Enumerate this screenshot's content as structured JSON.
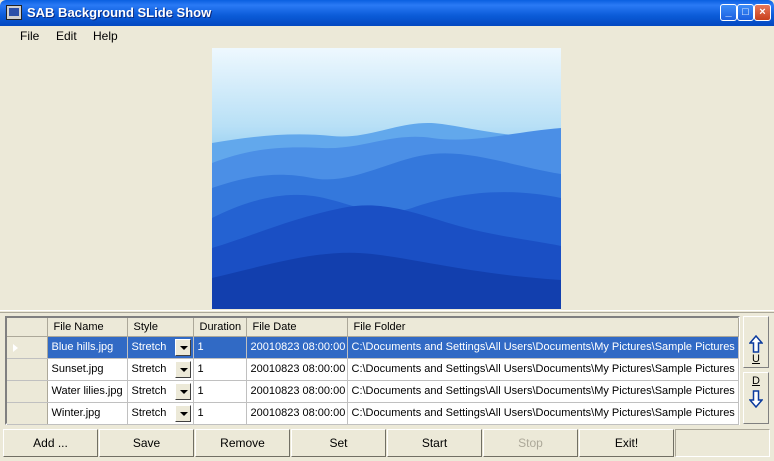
{
  "window": {
    "title": "SAB Background SLide Show",
    "controls": {
      "minimize": "_",
      "maximize": "□",
      "close": "×"
    }
  },
  "menu": [
    "File",
    "Edit",
    "Help"
  ],
  "preview": {
    "image": "blue hills landscape",
    "colors": {
      "sky": "#d4ecfb",
      "hill_near": "#0f3ea8",
      "hill_far": "#5a9ee6"
    }
  },
  "grid": {
    "columns": [
      "File Name",
      "Style",
      "Duration",
      "File Date",
      "File Folder"
    ],
    "rows": [
      {
        "file": "Blue hills.jpg",
        "style": "Stretch",
        "duration": "1",
        "date": "20010823 08:00:00",
        "folder": "C:\\Documents and Settings\\All Users\\Documents\\My Pictures\\Sample Pictures",
        "selected": true
      },
      {
        "file": "Sunset.jpg",
        "style": "Stretch",
        "duration": "1",
        "date": "20010823 08:00:00",
        "folder": "C:\\Documents and Settings\\All Users\\Documents\\My Pictures\\Sample Pictures",
        "selected": false
      },
      {
        "file": "Water lilies.jpg",
        "style": "Stretch",
        "duration": "1",
        "date": "20010823 08:00:00",
        "folder": "C:\\Documents and Settings\\All Users\\Documents\\My Pictures\\Sample Pictures",
        "selected": false
      },
      {
        "file": "Winter.jpg",
        "style": "Stretch",
        "duration": "1",
        "date": "20010823 08:00:00",
        "folder": "C:\\Documents and Settings\\All Users\\Documents\\My Pictures\\Sample Pictures",
        "selected": false
      }
    ],
    "selection_color": "#316ac5"
  },
  "side": {
    "up_label": "U",
    "down_label": "D",
    "up_icon": "up-arrow-icon",
    "down_icon": "down-arrow-icon"
  },
  "buttons": {
    "add": "Add ...",
    "save": "Save",
    "remove": "Remove",
    "set": "Set",
    "start": "Start",
    "stop": "Stop",
    "exit": "Exit!"
  }
}
